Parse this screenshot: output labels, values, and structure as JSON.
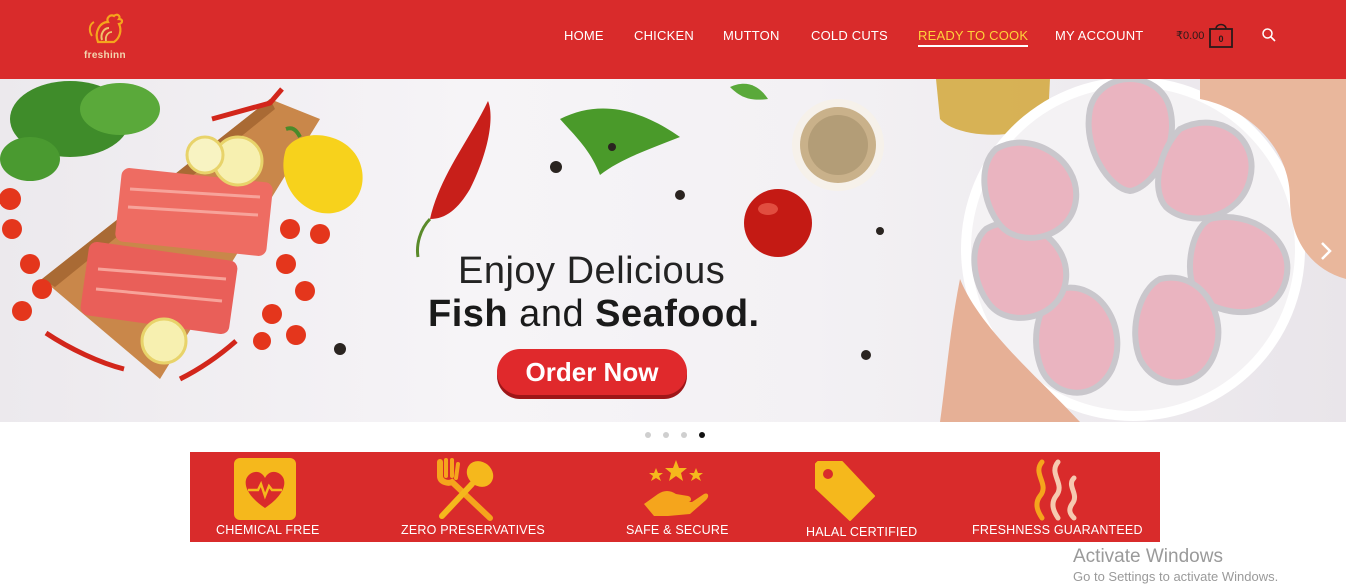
{
  "brand": {
    "name": "freshinn"
  },
  "nav": {
    "items": [
      {
        "label": "HOME"
      },
      {
        "label": "CHICKEN"
      },
      {
        "label": "MUTTON"
      },
      {
        "label": "COLD CUTS"
      },
      {
        "label": "READY TO COOK"
      },
      {
        "label": "MY ACCOUNT"
      }
    ],
    "active_item": "READY TO COOK"
  },
  "cart": {
    "amount": "₹0.00",
    "count": "0"
  },
  "hero": {
    "line1": "Enjoy Delicious",
    "line2_a": "Fish",
    "line2_b": " and ",
    "line2_c": "Seafood.",
    "cta_label": "Order Now"
  },
  "slider": {
    "slide_count": 4,
    "active_slide": 4
  },
  "features": [
    {
      "label": "CHEMICAL FREE",
      "icon": "heart-pulse-icon"
    },
    {
      "label": "ZERO PRESERVATIVES",
      "icon": "fork-spoon-icon"
    },
    {
      "label": "SAFE & SECURE",
      "icon": "hand-stars-icon"
    },
    {
      "label": "HALAL CERTIFIED",
      "icon": "tag-icon"
    },
    {
      "label": "FRESHNESS GUARANTEED",
      "icon": "steam-icon"
    }
  ],
  "watermark": {
    "title": "Activate Windows",
    "subtitle": "Go to Settings to activate Windows."
  },
  "colors": {
    "brand_red": "#d92b2b",
    "accent_yellow": "#ffd23a",
    "icon_orange": "#f5a51c"
  }
}
